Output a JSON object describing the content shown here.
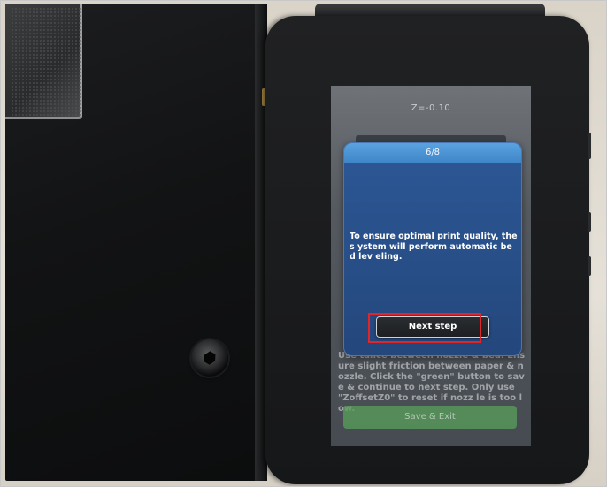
{
  "screen": {
    "z_value": "Z=-0.10",
    "background_instructions": "Use tance between nozzle & bed. Ensure slight friction between paper & nozzle. Click the \"green\" button to save & continue to next step. Only use \"ZoffsetZ0\" to reset if nozz le is too low.",
    "save_button_label": "Save & Exit"
  },
  "dialog": {
    "step": "6/8",
    "message": "To ensure optimal print quality, the s ystem will perform automatic bed lev eling.",
    "next_button_label": "Next step"
  },
  "colors": {
    "dialog_header": "#4a94d6",
    "dialog_body": "#2a5290",
    "highlight_box": "#e0262a",
    "save_button": "#58a05a"
  }
}
